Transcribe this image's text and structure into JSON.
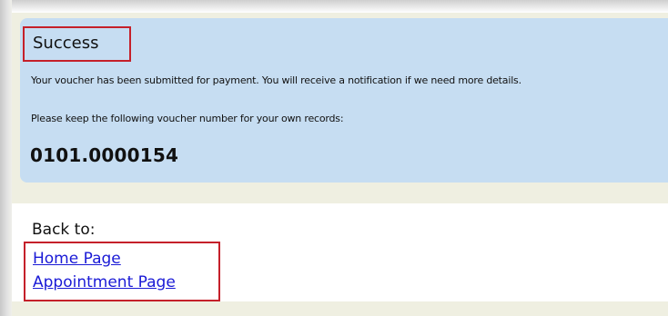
{
  "success": {
    "title": "Success",
    "message_line1": "Your voucher has been submitted for payment. You will receive a notification if we need more details.",
    "message_line2": "Please keep the following voucher number for your own records:",
    "voucher_number": "0101.0000154"
  },
  "navigation": {
    "back_label": "Back to:",
    "links": [
      {
        "label": "Home Page"
      },
      {
        "label": "Appointment Page"
      }
    ]
  },
  "colors": {
    "success_panel": "#c6ddf2",
    "page_background": "#efefe1",
    "highlight_border": "#c5202a",
    "link": "#1a1ad6"
  }
}
